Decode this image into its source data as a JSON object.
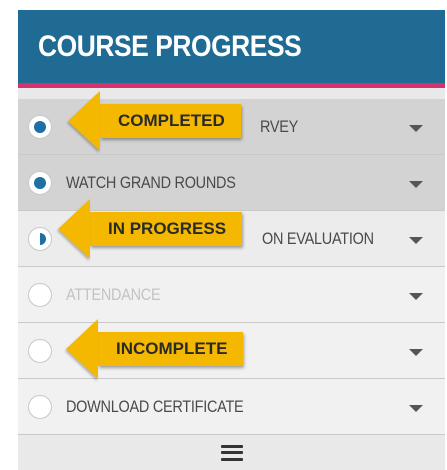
{
  "header": {
    "title": "COURSE PROGRESS"
  },
  "rows": [
    {
      "label": "COMPLETE PRE-ACTIVITY SURVEY",
      "visible_label": "RVEY",
      "status": "completed"
    },
    {
      "label": "WATCH GRAND ROUNDS",
      "visible_label": "WATCH GRAND ROUNDS",
      "status": "completed"
    },
    {
      "label": "COMPLETE POST-ACTIVITY ON EVALUATION",
      "visible_label": "ON EVALUATION",
      "status": "in-progress"
    },
    {
      "label": "ATTENDANCE",
      "visible_label": "ATTENDANCE",
      "status": "disabled"
    },
    {
      "label": "",
      "visible_label": "",
      "status": "incomplete"
    },
    {
      "label": "DOWNLOAD CERTIFICATE",
      "visible_label": "DOWNLOAD CERTIFICATE",
      "status": "incomplete"
    }
  ],
  "callouts": {
    "completed": "COMPLETED",
    "in_progress": "IN PROGRESS",
    "incomplete": "INCOMPLETE"
  },
  "footer": {
    "menu_icon": "hamburger-menu-icon"
  },
  "colors": {
    "header": "#1f6b94",
    "accent": "#d6336c",
    "status": "#1e6fa3",
    "callout": "#f5b800"
  }
}
